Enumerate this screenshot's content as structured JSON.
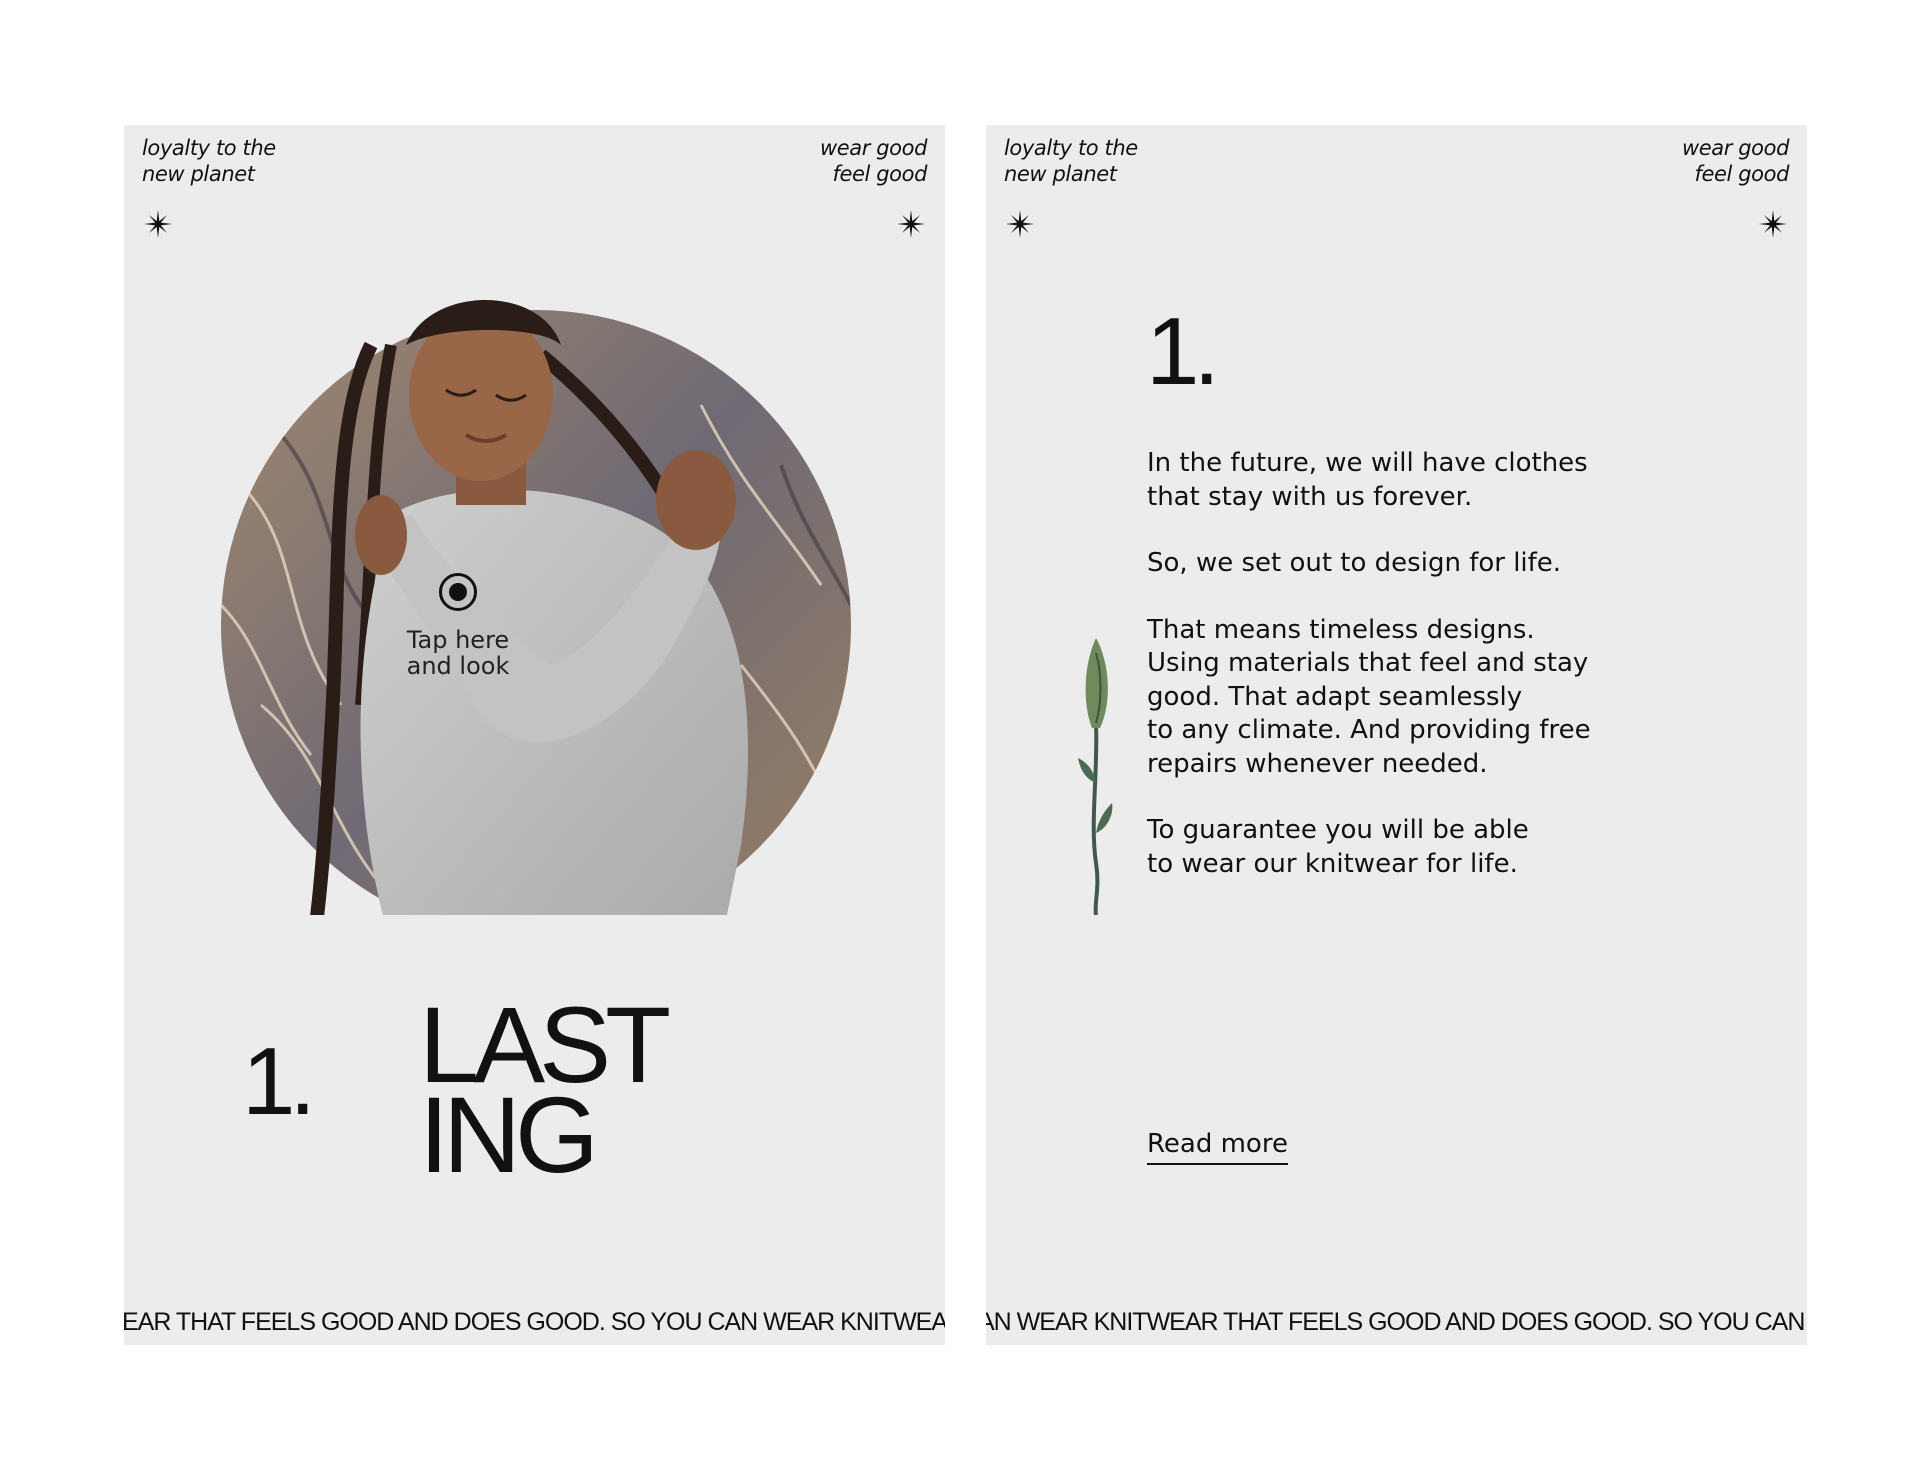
{
  "left_panel": {
    "tagline_left": [
      "loyalty to the",
      "new planet"
    ],
    "tagline_right": [
      "wear good",
      "feel good"
    ],
    "tap_label": [
      "Tap here",
      "and look"
    ],
    "number": "1.",
    "title": [
      "LAST",
      "ING"
    ],
    "marquee": "EAR THAT FEELS GOOD AND DOES GOOD.  SO YOU CAN WEAR KNITWEAR"
  },
  "right_panel": {
    "tagline_left": [
      "loyalty to the",
      "new planet"
    ],
    "tagline_right": [
      "wear good",
      "feel good"
    ],
    "number": "1.",
    "paragraphs": [
      [
        "In the future, we will have clothes",
        "that stay with us forever."
      ],
      [
        "So, we set out to design for life."
      ],
      [
        "That means timeless designs.",
        "Using materials that feel and stay",
        "good. That adapt seamlessly",
        "to any climate. And providing free",
        "repairs whenever needed."
      ],
      [
        "To guarantee you will be able",
        "to wear our knitwear for life."
      ]
    ],
    "read_more": "Read more",
    "marquee": "AN WEAR KNITWEAR THAT FEELS GOOD AND DOES GOOD.  SO YOU CAN WEAR"
  },
  "icons": {
    "corner": "sparkle-star-icon",
    "tap": "target-dot-icon"
  },
  "colors": {
    "panel_bg": "#ececec",
    "text": "#111111",
    "sweater": "#bdbdbd",
    "landscape": "#8a7460"
  }
}
